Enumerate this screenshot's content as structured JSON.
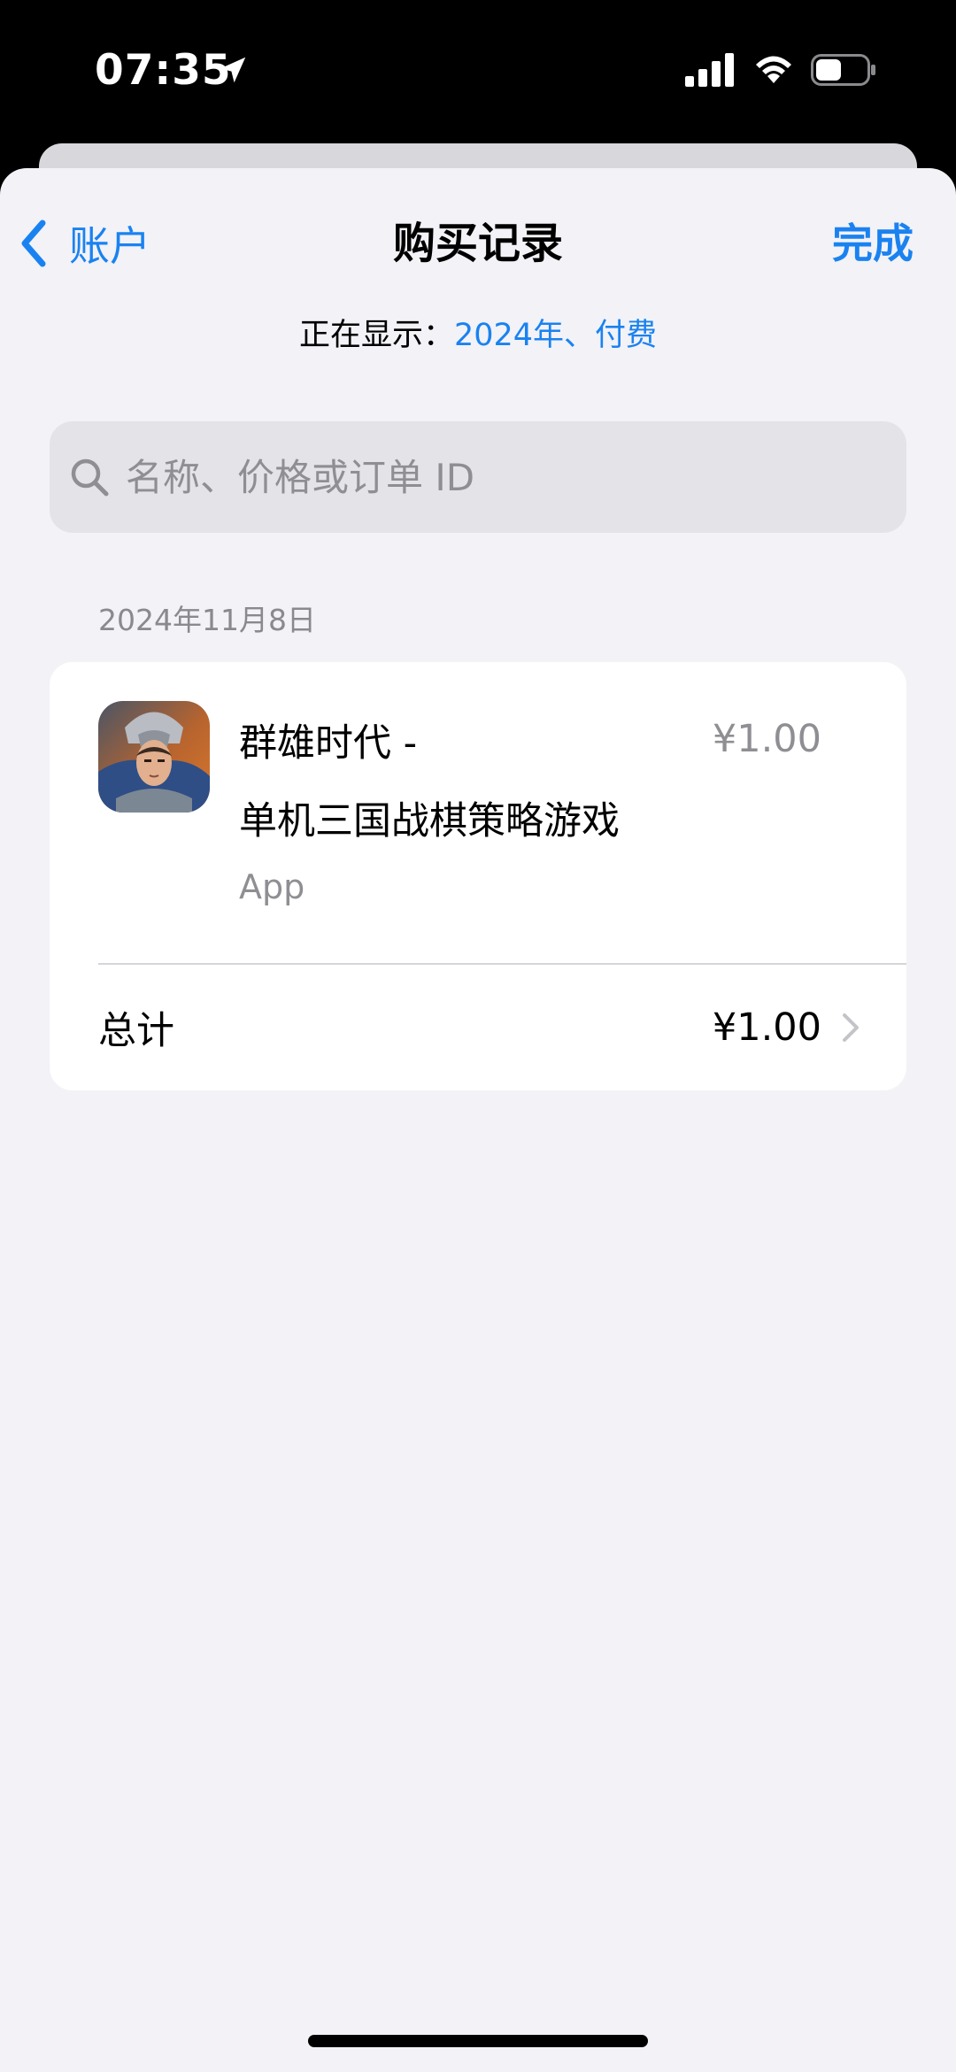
{
  "status_bar": {
    "time": "07:35",
    "icons": [
      "location-arrow-icon",
      "cellular-signal-icon",
      "wifi-icon",
      "battery-icon"
    ]
  },
  "nav": {
    "back_label": "账户",
    "title": "购买记录",
    "done_label": "完成"
  },
  "filter": {
    "label": "正在显示：",
    "value": "2024年、付费"
  },
  "search": {
    "placeholder": "名称、价格或订单 ID",
    "value": ""
  },
  "purchases": [
    {
      "date": "2024年11月8日",
      "item": {
        "title_line1": "群雄时代 -",
        "title_line2": "单机三国战棋策略游戏",
        "type": "App",
        "price": "¥1.00"
      },
      "total_label": "总计",
      "total_amount": "¥1.00"
    }
  ],
  "colors": {
    "accent": "#1a82f0",
    "background": "#f2f2f7",
    "secondary_text": "#8e8e93"
  }
}
